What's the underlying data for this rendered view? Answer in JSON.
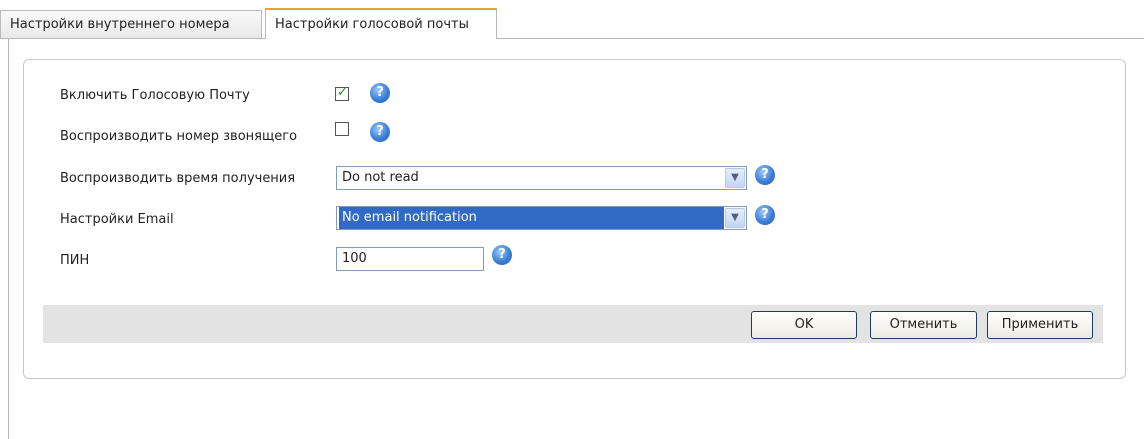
{
  "tabs": [
    {
      "label": "Настройки внутреннего номера"
    },
    {
      "label": "Настройки голосовой почты"
    }
  ],
  "form": {
    "voicemail_enable": {
      "label": "Включить Голосовую Почту",
      "checked": true
    },
    "play_caller_number": {
      "label": "Воспроизводить номер звонящего",
      "checked": false
    },
    "play_time": {
      "label": "Воспроизводить время получения",
      "value": "Do not read"
    },
    "email_settings": {
      "label": "Настройки Email",
      "value": "No email notification"
    },
    "pin": {
      "label": "ПИН",
      "value": "100"
    }
  },
  "help_symbol": "?",
  "icons": {
    "help": "help-icon",
    "check": "checkmark-icon",
    "dropdown": "chevron-down-icon"
  },
  "buttons": {
    "ok": "OK",
    "cancel": "Отменить",
    "apply": "Применить"
  }
}
